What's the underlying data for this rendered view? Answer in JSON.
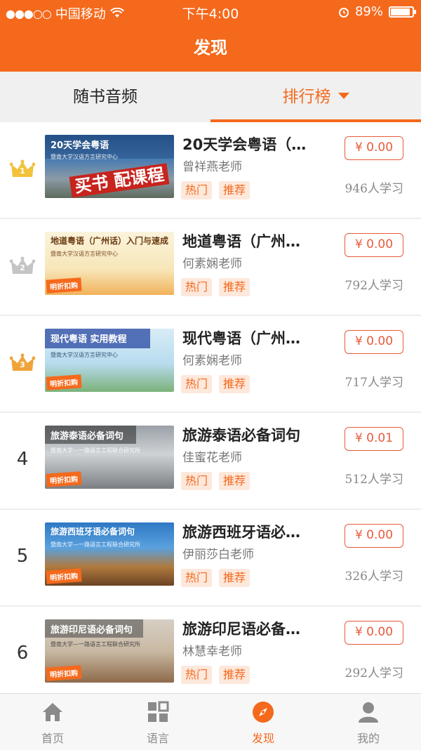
{
  "status_bar": {
    "carrier": "中国移动",
    "time": "下午4:00",
    "battery_percent": "89%",
    "battery_level": 0.89
  },
  "header": {
    "title": "发现"
  },
  "tabs": [
    {
      "label": "随书音频",
      "active": false
    },
    {
      "label": "排行榜",
      "active": true
    }
  ],
  "courses": [
    {
      "rank": "1",
      "thumb_title": "20天学会粤语",
      "thumb_sub": "暨南大学汉语方言研究中心",
      "thumb_promo": "买书 配课程",
      "title": "20天学会粤语（…",
      "teacher": "曾祥燕老师",
      "tags": [
        "热门",
        "推荐"
      ],
      "price": "¥ 0.00",
      "learners": "946人学习"
    },
    {
      "rank": "2",
      "thumb_title": "地道粤语（广州话）入门与速成",
      "thumb_sub": "暨南大学汉语方言研究中心",
      "thumb_promo": "明折扣购",
      "title": "地道粤语（广州…",
      "teacher": "何素娴老师",
      "tags": [
        "热门",
        "推荐"
      ],
      "price": "¥ 0.00",
      "learners": "792人学习"
    },
    {
      "rank": "3",
      "thumb_title": "现代粤语 实用教程",
      "thumb_sub": "暨南大学汉语方言研究中心",
      "thumb_promo": "明折扣购",
      "title": "现代粤语（广州…",
      "teacher": "何素娴老师",
      "tags": [
        "热门",
        "推荐"
      ],
      "price": "¥ 0.00",
      "learners": "717人学习"
    },
    {
      "rank": "4",
      "thumb_title": "旅游泰语必备词句",
      "thumb_sub": "暨南大学—一路语言工程联合研究所",
      "thumb_promo": "明折扣购",
      "title": "旅游泰语必备词句",
      "teacher": "佳蜜花老师",
      "tags": [
        "热门",
        "推荐"
      ],
      "price": "¥ 0.01",
      "learners": "512人学习"
    },
    {
      "rank": "5",
      "thumb_title": "旅游西班牙语必备词句",
      "thumb_sub": "暨南大学—一路语言工程联合研究所",
      "thumb_promo": "明折扣购",
      "title": "旅游西班牙语必…",
      "teacher": "伊丽莎白老师",
      "tags": [
        "热门",
        "推荐"
      ],
      "price": "¥ 0.00",
      "learners": "326人学习"
    },
    {
      "rank": "6",
      "thumb_title": "旅游印尼语必备词句",
      "thumb_sub": "暨南大学—一路语言工程联合研究所",
      "thumb_promo": "明折扣购",
      "title": "旅游印尼语必备…",
      "teacher": "林慧幸老师",
      "tags": [
        "热门",
        "推荐"
      ],
      "price": "¥ 0.00",
      "learners": "292人学习"
    }
  ],
  "bottom_nav": [
    {
      "label": "首页",
      "icon": "home-icon",
      "active": false
    },
    {
      "label": "语言",
      "icon": "grid-icon",
      "active": false
    },
    {
      "label": "发现",
      "icon": "compass-icon",
      "active": true
    },
    {
      "label": "我的",
      "icon": "person-icon",
      "active": false
    }
  ],
  "colors": {
    "accent": "#f5691c",
    "price_red": "#e85a3b",
    "gold": "#f2c23a",
    "silver": "#c4c4c4",
    "bronze": "#f0a33a"
  }
}
